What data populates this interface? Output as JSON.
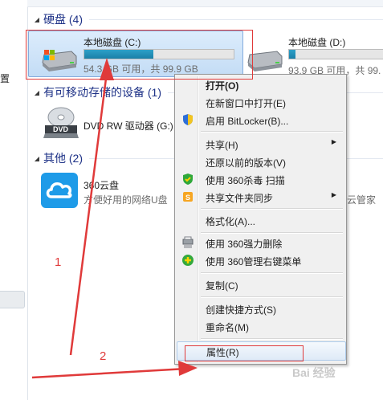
{
  "nav": {
    "partial_label": "置"
  },
  "groups": {
    "hard_disks": "硬盘 (4)",
    "removable": "有可移动存储的设备 (1)",
    "other": "其他 (2)"
  },
  "drives": [
    {
      "name": "本地磁盘 (C:)",
      "free": "54.3 GB 可用，共 99.9 GB",
      "used_fraction": 0.46,
      "selected": true
    },
    {
      "name": "本地磁盘 (D:)",
      "free": "93.9 GB 可用，共 99.",
      "used_fraction": 0.06,
      "selected": false
    }
  ],
  "dvd": {
    "name": "DVD RW 驱动器 (G:)",
    "icon_text": "DVD"
  },
  "other_items": [
    {
      "name": "360云盘",
      "desc": "方便好用的网络U盘"
    },
    {
      "name": "",
      "desc": "云管家"
    }
  ],
  "menu": {
    "items": [
      {
        "label": "打开(O)",
        "bold": true,
        "icon": "",
        "submenu": false
      },
      {
        "label": "在新窗口中打开(E)",
        "bold": false,
        "icon": "",
        "submenu": false
      },
      {
        "label": "启用 BitLocker(B)...",
        "bold": false,
        "icon": "shield-icon",
        "submenu": false
      },
      {
        "label": "共享(H)",
        "bold": false,
        "icon": "",
        "submenu": true
      },
      {
        "label": "还原以前的版本(V)",
        "bold": false,
        "icon": "",
        "submenu": false
      },
      {
        "label": "使用 360杀毒 扫描",
        "bold": false,
        "icon": "360-antivirus-icon",
        "submenu": false
      },
      {
        "label": "共享文件夹同步",
        "bold": false,
        "icon": "sync-icon",
        "submenu": true
      },
      {
        "label": "格式化(A)...",
        "bold": false,
        "icon": "",
        "submenu": false
      },
      {
        "label": "使用 360强力删除",
        "bold": false,
        "icon": "shredder-icon",
        "submenu": false
      },
      {
        "label": "使用 360管理右键菜单",
        "bold": false,
        "icon": "360-manager-icon",
        "submenu": false
      },
      {
        "label": "复制(C)",
        "bold": false,
        "icon": "",
        "submenu": false
      },
      {
        "label": "创建快捷方式(S)",
        "bold": false,
        "icon": "",
        "submenu": false
      },
      {
        "label": "重命名(M)",
        "bold": false,
        "icon": "",
        "submenu": false
      },
      {
        "label": "属性(R)",
        "bold": false,
        "icon": "",
        "submenu": false
      }
    ]
  },
  "annotations": {
    "step1": "1",
    "step2": "2"
  },
  "watermark": "Bai 经验",
  "colors": {
    "annotation_red": "#e03a3a",
    "group_title": "#1e3287",
    "bar_fill": "#1a8fb8"
  }
}
